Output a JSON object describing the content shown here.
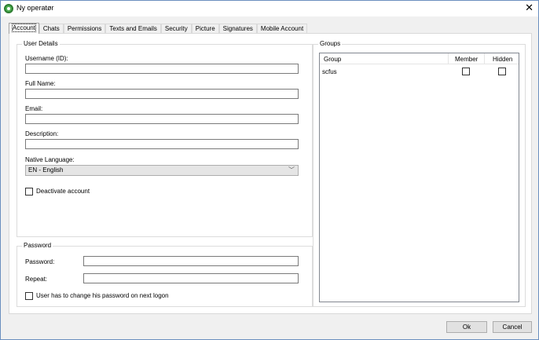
{
  "window": {
    "title": "Ny operatør"
  },
  "tabs": [
    "Account",
    "Chats",
    "Permissions",
    "Texts and Emails",
    "Security",
    "Picture",
    "Signatures",
    "Mobile Account"
  ],
  "user_details": {
    "legend": "User Details",
    "username_label": "Username (ID):",
    "username_value": "",
    "fullname_label": "Full Name:",
    "fullname_value": "",
    "email_label": "Email:",
    "email_value": "",
    "description_label": "Description:",
    "description_value": "",
    "language_label": "Native Language:",
    "language_value": "EN - English",
    "deactivate_label": "Deactivate account"
  },
  "password": {
    "legend": "Password",
    "password_label": "Password:",
    "password_value": "",
    "repeat_label": "Repeat:",
    "repeat_value": "",
    "change_label": "User has to change his password on next logon"
  },
  "groups": {
    "legend": "Groups",
    "columns": [
      "Group",
      "Member",
      "Hidden"
    ],
    "rows": [
      {
        "group": "scfus",
        "member": false,
        "hidden": false
      }
    ]
  },
  "buttons": {
    "ok": "Ok",
    "cancel": "Cancel"
  }
}
